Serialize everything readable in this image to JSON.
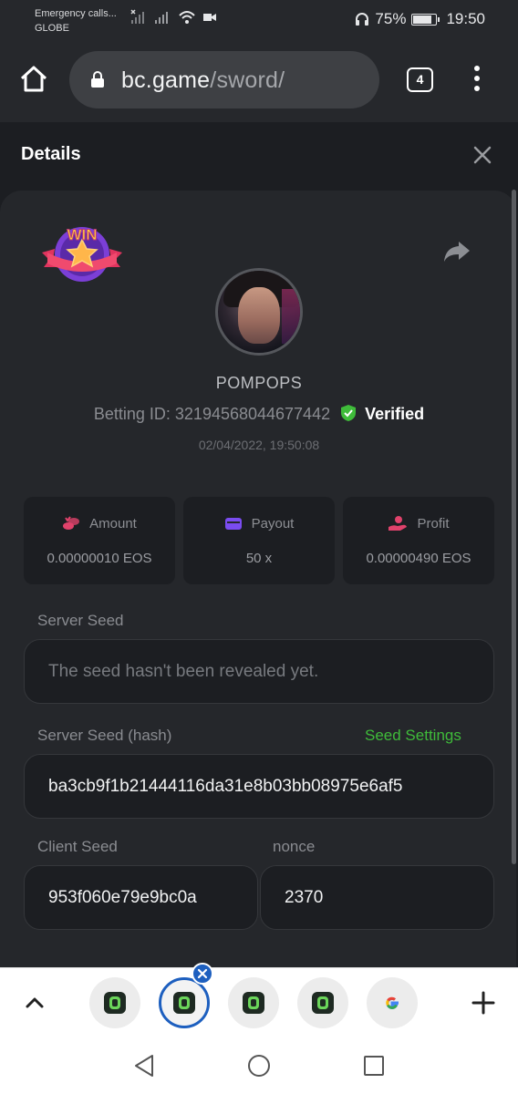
{
  "status_bar": {
    "carrier_line1": "Emergency calls...",
    "carrier_line2": "GLOBE",
    "battery_percent": "75%",
    "battery_level": 0.75,
    "time": "19:50"
  },
  "browser": {
    "url_host": "bc.game",
    "url_path": "/sword/",
    "tab_count": "4"
  },
  "modal": {
    "title": "Details"
  },
  "bet": {
    "badge_text": "WIN",
    "username": "POMPOPS",
    "betting_id_label": "Betting ID:",
    "betting_id": "32194568044677442",
    "verified_label": "Verified",
    "date": "02/04/2022, 19:50:08"
  },
  "stats": [
    {
      "label": "Amount",
      "value": "0.00000010 EOS",
      "icon": "coins-icon",
      "color": "#e0426b"
    },
    {
      "label": "Payout",
      "value": "50 x",
      "icon": "wallet-icon",
      "color": "#7a4cf0"
    },
    {
      "label": "Profit",
      "value": "0.00000490 EOS",
      "icon": "hand-coin-icon",
      "color": "#e0426b"
    }
  ],
  "seeds": {
    "server_seed_label": "Server Seed",
    "server_seed_placeholder": "The seed hasn't been revealed yet.",
    "server_seed_hash_label": "Server Seed (hash)",
    "seed_settings_link": "Seed Settings",
    "server_seed_hash": "ba3cb9f1b21444116da31e8b03bb08975e6af5",
    "client_seed_label": "Client Seed",
    "client_seed": "953f060e79e9bc0a",
    "nonce_label": "nonce",
    "nonce": "2370"
  },
  "colors": {
    "accent_green": "#3fbb3a",
    "background": "#1c1e22",
    "card": "#25272b"
  }
}
